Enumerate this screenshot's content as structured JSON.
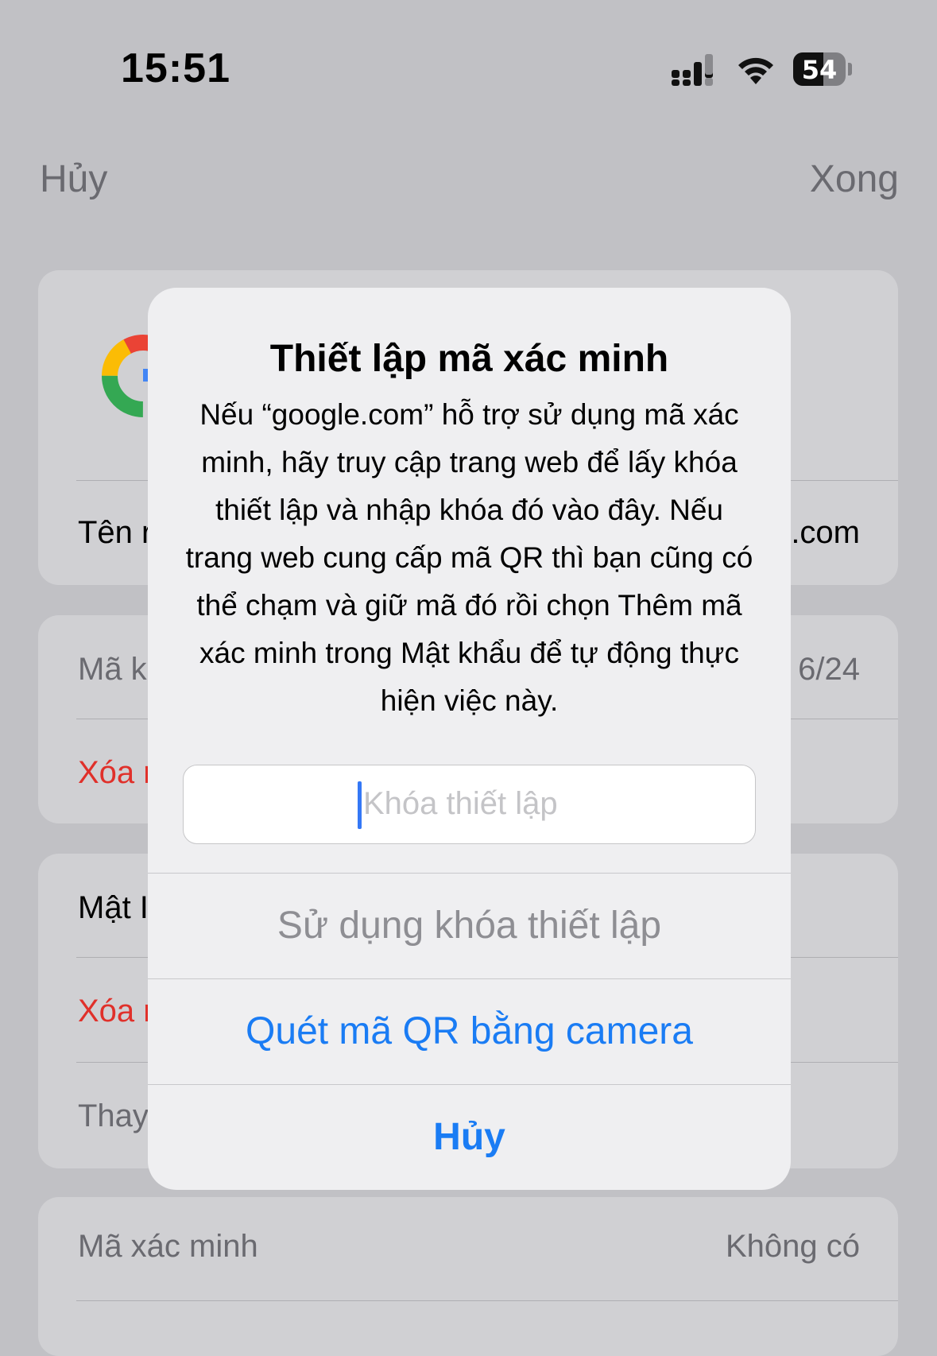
{
  "status_bar": {
    "time": "15:51",
    "battery": "54"
  },
  "nav": {
    "cancel": "Hủy",
    "done": "Xong"
  },
  "background": {
    "card1": {
      "row_label": "Tên r",
      "row_value": ".com"
    },
    "card2": {
      "row1_label": "Mã k",
      "row1_value": "6/24",
      "row2_label": "Xóa r"
    },
    "card3": {
      "row1_label": "Mật I",
      "row2_label": "Xóa r",
      "row3_label": "Thay"
    },
    "card4": {
      "row_label": "Mã xác minh",
      "row_value": "Không có"
    }
  },
  "dialog": {
    "title": "Thiết lập mã xác minh",
    "message": "Nếu “google.com” hỗ trợ sử dụng mã xác minh, hãy truy cập trang web để lấy khóa thiết lập và nhập khóa đó vào đây. Nếu trang web cung cấp mã QR thì bạn cũng có thể chạm và giữ mã đó rồi chọn Thêm mã xác minh trong Mật khẩu để tự động thực hiện việc này.",
    "input_placeholder": "Khóa thiết lập",
    "use_key_button": "Sử dụng khóa thiết lập",
    "scan_qr_button": "Quét mã QR bằng camera",
    "cancel_button": "Hủy"
  },
  "colors": {
    "accent": "#1a7cf4",
    "destructive": "#e0302a"
  }
}
